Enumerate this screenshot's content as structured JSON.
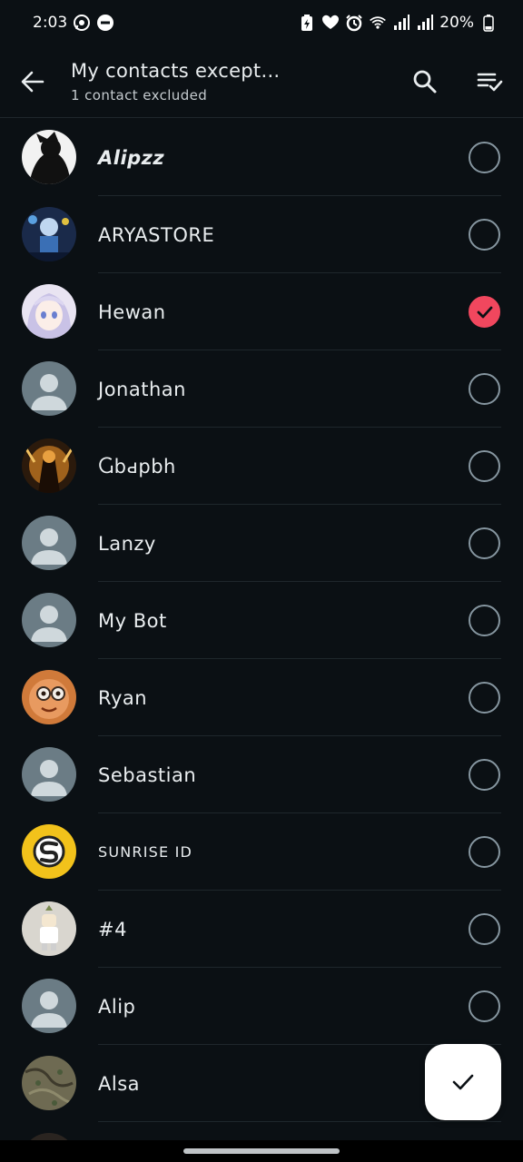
{
  "status_bar": {
    "time": "2:03",
    "battery_text": "20%"
  },
  "header": {
    "title": "My contacts except...",
    "subtitle": "1 contact excluded"
  },
  "contacts": [
    {
      "name": "Alipzz",
      "checked": false,
      "avatar": "photo-dark"
    },
    {
      "name": "ARYASTORE",
      "checked": false,
      "avatar": "photo-blue"
    },
    {
      "name": "Hewan",
      "checked": true,
      "avatar": "photo-anime"
    },
    {
      "name": "Jonathan",
      "checked": false,
      "avatar": "default"
    },
    {
      "name": "Ⴚbԁpbh",
      "checked": false,
      "avatar": "photo-gold"
    },
    {
      "name": "Lanzy",
      "checked": false,
      "avatar": "default"
    },
    {
      "name": "My Bot",
      "checked": false,
      "avatar": "default"
    },
    {
      "name": "Ryan",
      "checked": false,
      "avatar": "photo-face"
    },
    {
      "name": "Sebastian",
      "checked": false,
      "avatar": "default"
    },
    {
      "name": "SUNRISE ID",
      "checked": false,
      "avatar": "photo-logo"
    },
    {
      "name": "#4",
      "checked": false,
      "avatar": "photo-toy"
    },
    {
      "name": "Alip",
      "checked": false,
      "avatar": "default"
    },
    {
      "name": "Alsa",
      "checked": false,
      "avatar": "photo-ground"
    }
  ],
  "colors": {
    "background": "#0b1014",
    "accent_check": "#f1475e",
    "fab": "#ffffff"
  },
  "icons": {
    "back": "arrow-left-icon",
    "search": "search-icon",
    "select_all": "select-all-icon",
    "confirm": "checkmark-icon"
  }
}
